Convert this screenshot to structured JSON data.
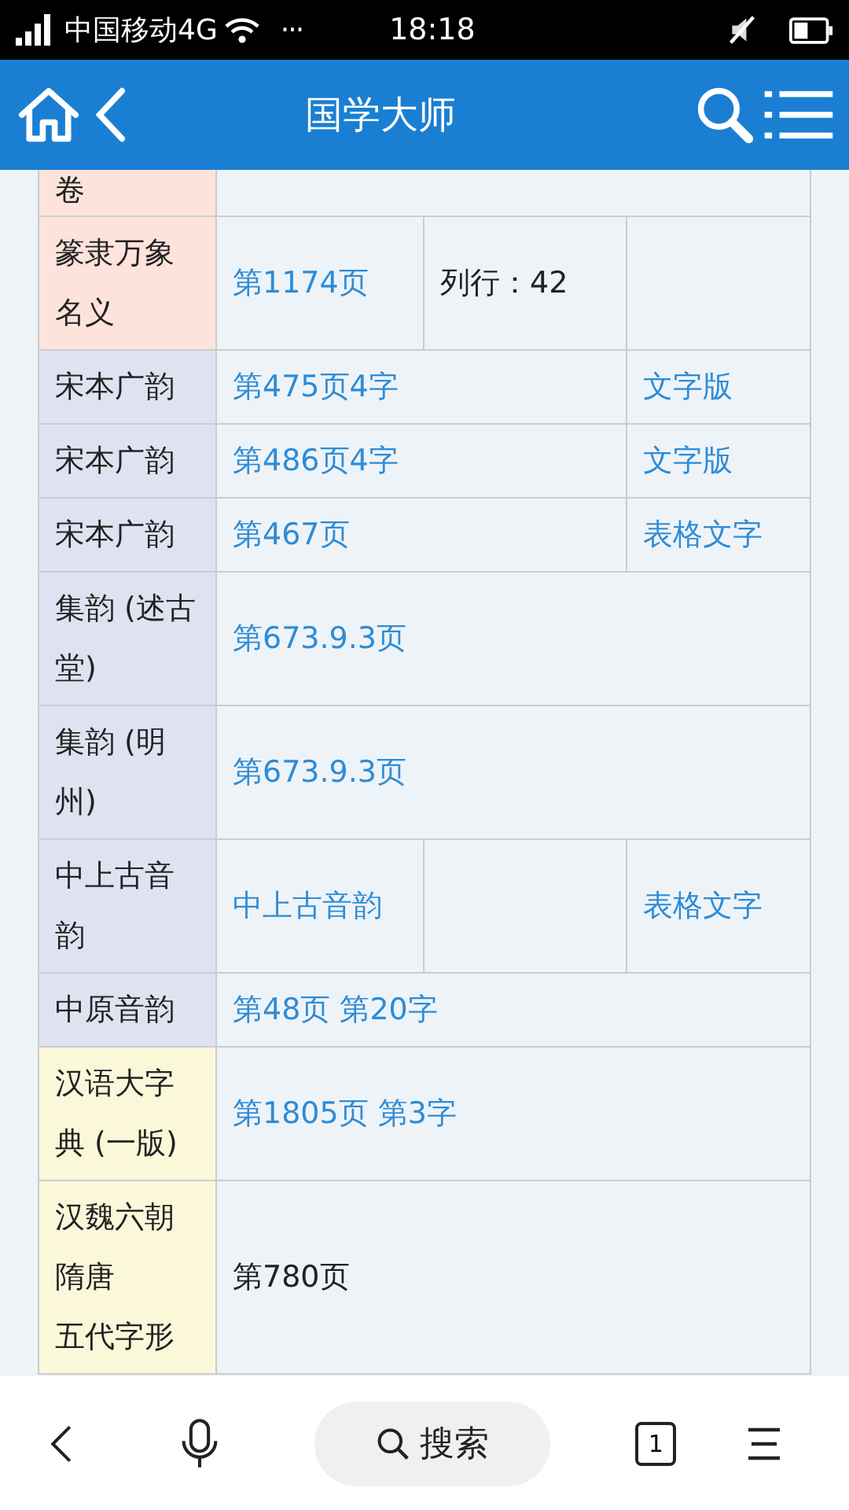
{
  "status_bar": {
    "carrier": "中国移动4G",
    "more": "···",
    "time": "18:18"
  },
  "header": {
    "title": "国学大师"
  },
  "table": {
    "rows": [
      {
        "label": "卷",
        "color": "#fde3dc",
        "cells": [
          {
            "kind": "blank"
          }
        ]
      },
      {
        "label": "篆隶万象名义",
        "color": "#fde3dc",
        "cells": [
          {
            "text": "第1174页",
            "kind": "link"
          },
          {
            "text": "列行：42",
            "kind": "text"
          },
          {
            "kind": "blank"
          }
        ]
      },
      {
        "label": "宋本广韵",
        "color": "#dfe2f1",
        "cells": [
          {
            "text": "第475页4字",
            "kind": "link"
          },
          {
            "text": "文字版",
            "kind": "link"
          }
        ]
      },
      {
        "label": "宋本广韵",
        "color": "#dfe2f1",
        "cells": [
          {
            "text": "第486页4字",
            "kind": "link"
          },
          {
            "text": "文字版",
            "kind": "link"
          }
        ]
      },
      {
        "label": "宋本广韵",
        "color": "#dfe2f1",
        "cells": [
          {
            "text": "第467页",
            "kind": "link"
          },
          {
            "text": "表格文字",
            "kind": "link"
          }
        ]
      },
      {
        "label": "集韵 (述古堂)",
        "color": "#dfe2f1",
        "cells": [
          {
            "text": "第673.9.3页",
            "kind": "link"
          }
        ]
      },
      {
        "label": "集韵 (明州)",
        "color": "#dfe2f1",
        "cells": [
          {
            "text": "第673.9.3页",
            "kind": "link"
          }
        ]
      },
      {
        "label": "中上古音韵",
        "color": "#dfe2f1",
        "cells": [
          {
            "text": "中上古音韵",
            "kind": "link"
          },
          {
            "kind": "blank"
          },
          {
            "text": "表格文字",
            "kind": "link"
          }
        ]
      },
      {
        "label": "中原音韵",
        "color": "#dfe2f1",
        "cells": [
          {
            "text": "第48页 第20字",
            "kind": "link"
          }
        ]
      },
      {
        "label": "汉语大字典 (一版)",
        "color": "#fbf8da",
        "cells": [
          {
            "text": "第1805页 第3字",
            "kind": "link"
          }
        ]
      },
      {
        "label": [
          "汉魏六朝",
          "隋唐",
          "五代字形"
        ],
        "color": "#fbf8da",
        "cells": [
          {
            "text": "第780页",
            "kind": "text"
          }
        ]
      }
    ]
  },
  "bottom_bar": {
    "search_label": "搜索",
    "tab_count": "1"
  }
}
